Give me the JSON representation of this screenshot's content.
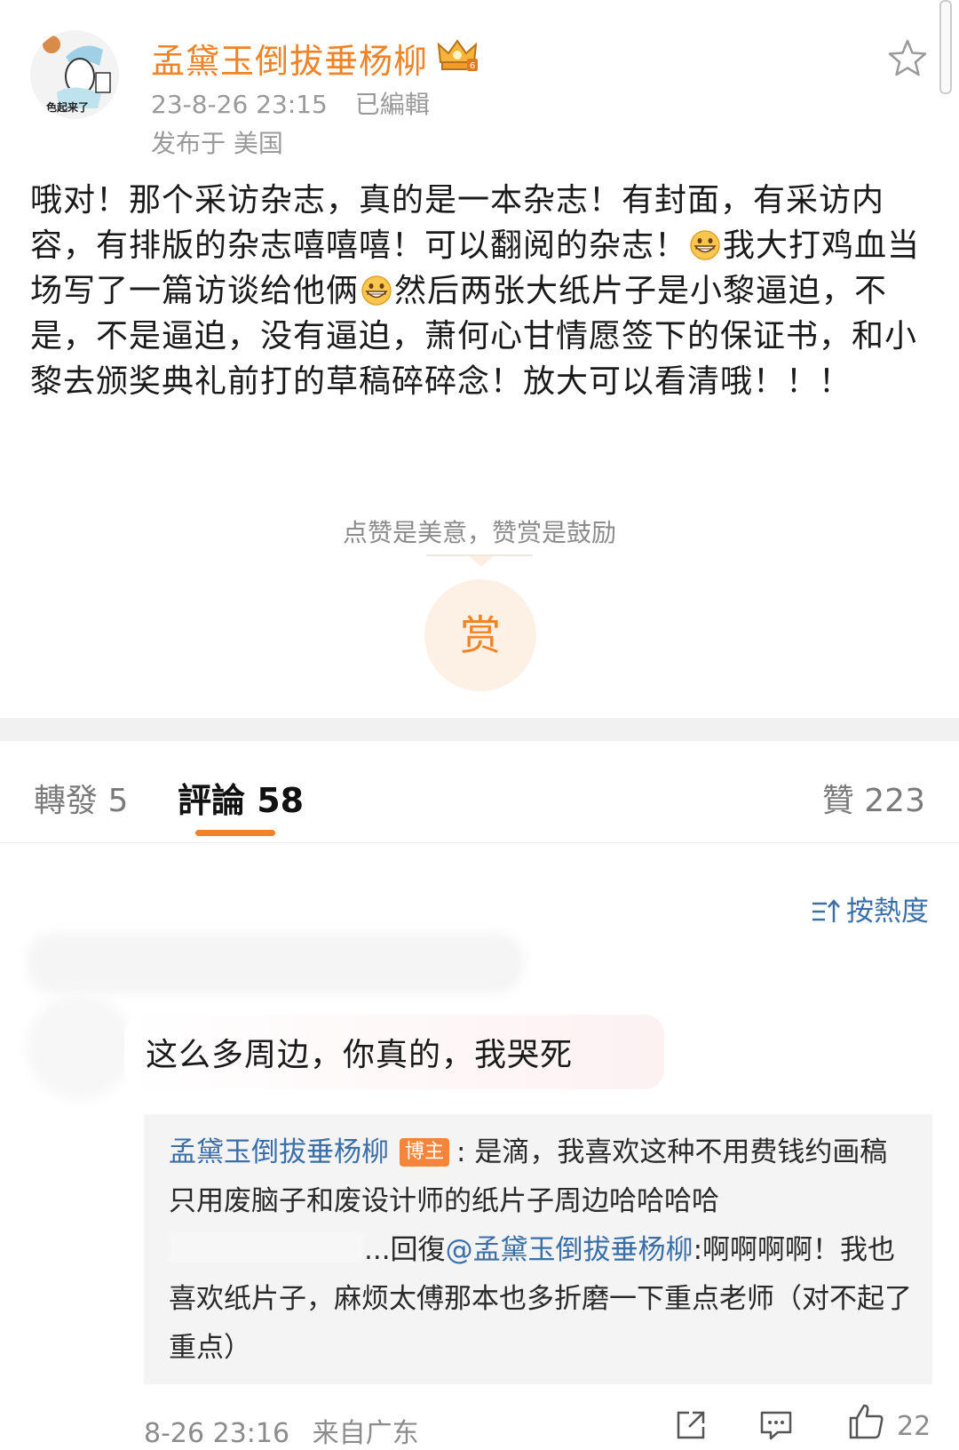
{
  "post": {
    "author": "孟黛玉倒拔垂杨柳",
    "time": "23-8-26 23:15",
    "edited": "已編輯",
    "location": "发布于 美国",
    "body_1": "哦对！那个采访杂志，真的是一本杂志！有封面，有采访内容，有排版的杂志嘻嘻嘻！可以翻阅的杂志！",
    "body_2": "我大打鸡血当场写了一篇访谈给他俩",
    "body_3": "然后两张大纸片子是小黎逼迫，不是，不是逼迫，没有逼迫，萧何心甘情愿签下的保证书，和小黎去颁奖典礼前打的草稿碎碎念！放大可以看清哦！！！",
    "avatar_caption": "色起来了"
  },
  "reward": {
    "caption": "点赞是美意，赞赏是鼓励",
    "button": "赏"
  },
  "tabs": {
    "repost": "轉發 5",
    "comments": "評論 58",
    "likes": "贊 223"
  },
  "sort": {
    "label": "按熱度"
  },
  "comment": {
    "text": "这么多周边，你真的，我哭死",
    "reply_author": "孟黛玉倒拔垂杨柳",
    "badge": "博主",
    "reply_text": ": 是滴，我喜欢这种不用费钱约画稿只用废脑子和废设计师的纸片子周边哈哈哈哈",
    "reply2_prefix": "...回復",
    "reply2_mention": "@孟黛玉倒拔垂杨柳",
    "reply2_text": ":啊啊啊啊！我也喜欢纸片子，麻烦太傅那本也多折磨一下重点老师（对不起了重点）",
    "time": "8-26 23:16",
    "source": "来自广东",
    "like_count": "22"
  },
  "colors": {
    "accent": "#f08325",
    "link": "#3b6fa8",
    "meta": "#9a9a9a"
  },
  "icons": [
    "star-icon",
    "crown-vip-icon",
    "grin-emoji-icon",
    "sort-icon",
    "share-icon",
    "comment-icon",
    "like-icon"
  ]
}
